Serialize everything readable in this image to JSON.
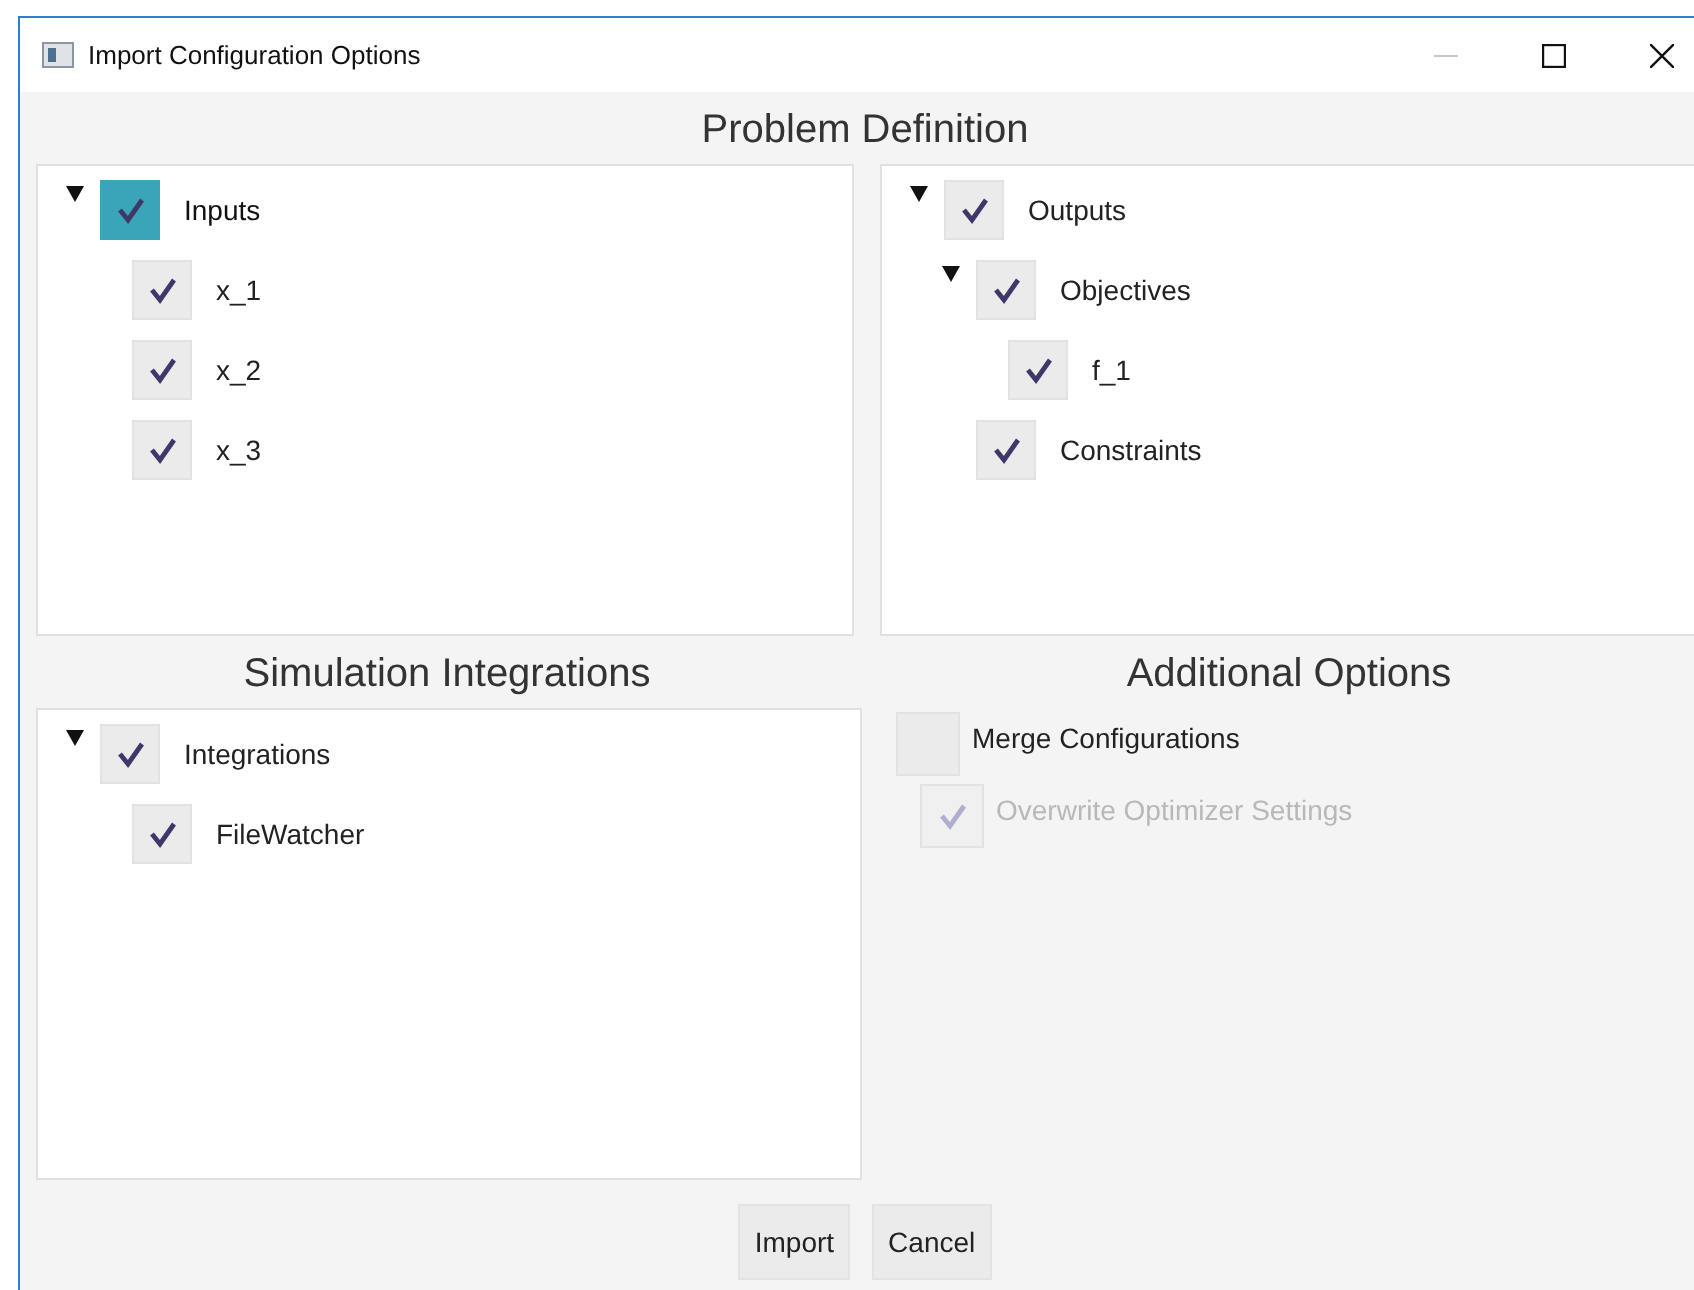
{
  "window": {
    "title": "Import Configuration Options"
  },
  "problem_definition": {
    "title": "Problem Definition",
    "trees": [
      [
        {
          "label": "Inputs",
          "checked": true,
          "selected": true,
          "expanded": true,
          "children": [
            {
              "label": "x_1",
              "checked": true,
              "selected": false
            },
            {
              "label": "x_2",
              "checked": true,
              "selected": false
            },
            {
              "label": "x_3",
              "checked": true,
              "selected": false
            }
          ]
        }
      ],
      [
        {
          "label": "Outputs",
          "checked": true,
          "selected": false,
          "expanded": true,
          "children": [
            {
              "label": "Objectives",
              "checked": true,
              "selected": false,
              "expanded": true,
              "children": [
                {
                  "label": "f_1",
                  "checked": true,
                  "selected": false
                }
              ]
            },
            {
              "label": "Constraints",
              "checked": true,
              "selected": false
            }
          ]
        }
      ]
    ]
  },
  "simulation_integrations": {
    "title": "Simulation Integrations",
    "tree": [
      {
        "label": "Integrations",
        "checked": true,
        "selected": false,
        "expanded": true,
        "children": [
          {
            "label": "FileWatcher",
            "checked": true,
            "selected": false
          }
        ]
      }
    ]
  },
  "additional_options": {
    "title": "Additional Options",
    "options": [
      {
        "label": "Merge Configurations",
        "checked": false,
        "disabled": false,
        "children": [
          {
            "label": "Overwrite Optimizer Settings",
            "checked": true,
            "disabled": true
          }
        ]
      }
    ]
  },
  "buttons": [
    {
      "label": "Import"
    },
    {
      "label": "Cancel"
    }
  ]
}
